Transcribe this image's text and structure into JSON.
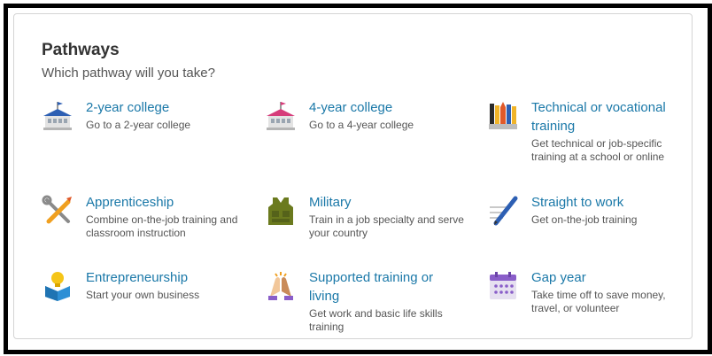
{
  "heading": "Pathways",
  "subheading": "Which pathway will you take?",
  "accent_color": "#1a78a8",
  "pathways": [
    {
      "title": "2-year college",
      "desc": "Go to a 2-year college",
      "icon": "school-blue-flag-icon"
    },
    {
      "title": "4-year college",
      "desc": "Go to a 4-year college",
      "icon": "school-pink-flag-icon"
    },
    {
      "title": "Technical or vocational training",
      "desc": "Get technical or job-specific training at a school or online",
      "icon": "pencil-cup-icon"
    },
    {
      "title": "Apprenticeship",
      "desc": "Combine on-the-job training and classroom instruction",
      "icon": "tools-icon"
    },
    {
      "title": "Military",
      "desc": "Train in a job specialty and serve your country",
      "icon": "vest-icon"
    },
    {
      "title": "Straight to work",
      "desc": "Get on-the-job training",
      "icon": "pen-paper-icon"
    },
    {
      "title": "Entrepreneurship",
      "desc": "Start your own business",
      "icon": "lightbulb-box-icon"
    },
    {
      "title": "Supported training or living",
      "desc": "Get work and basic life skills training",
      "icon": "high-five-icon"
    },
    {
      "title": "Gap year",
      "desc": "Take time off to save money, travel, or volunteer",
      "icon": "calendar-icon"
    }
  ]
}
